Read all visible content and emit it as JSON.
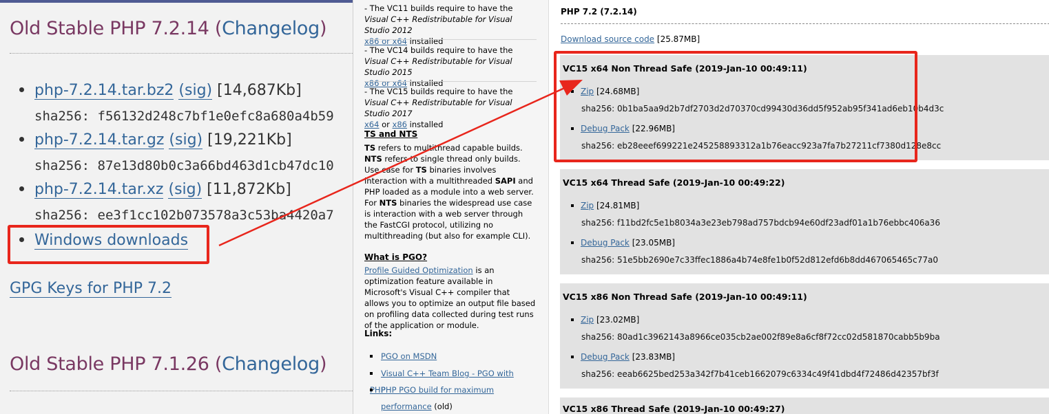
{
  "left": {
    "title1_pre": "Old Stable PHP 7.2.14 (",
    "title1_link": "Changelog",
    "title1_post": ")",
    "files": [
      {
        "name": "php-7.2.14.tar.bz2",
        "sig": "(sig)",
        "size": "[14,687Kb]",
        "sha": "sha256: f56132d248c7bf1e0efc8a680a4b59"
      },
      {
        "name": "php-7.2.14.tar.gz",
        "sig": "(sig)",
        "size": "[19,221Kb]",
        "sha": "sha256: 87e13d80b0c3a66bd463d1cb47dc10"
      },
      {
        "name": "php-7.2.14.tar.xz",
        "sig": "(sig)",
        "size": "[11,872Kb]",
        "sha": "sha256: ee3f1cc102b073578a3c53ba4420a7"
      }
    ],
    "windows_downloads": "Windows downloads",
    "gpg_keys": "GPG Keys for PHP 7.2",
    "title2_pre": "Old Stable PHP 7.1.26 (",
    "title2_link": "Changelog",
    "title2_post": ")"
  },
  "mid": {
    "vc11_a": "- The VC11 builds require to have the ",
    "vc11_i": "Visual C++ Redistributable for Visual Studio 2012",
    "vc11_link": "x86 or x64",
    "vc11_b": " installed",
    "vc14_a": "- The VC14 builds require to have the ",
    "vc14_i": "Visual C++ Redistributable for Visual Studio 2015",
    "vc14_link": "x86 or x64",
    "vc14_b": " installed",
    "vc15_a": "- The VC15 builds require to have the ",
    "vc15_i": "Visual C++ Redistributable for Visual Studio 2017",
    "vc15_link1": "x64",
    "vc15_or": " or ",
    "vc15_link2": "x86",
    "vc15_b": " installed",
    "ts_heading": "TS and NTS",
    "ts_1": "TS",
    "ts_2": " refers to multithread capable builds. ",
    "ts_3": "NTS",
    "ts_4": " refers to single thread only builds. Use case for ",
    "ts_5": "TS",
    "ts_6": " binaries involves interaction with a multithreaded ",
    "ts_7": "SAPI",
    "ts_8": " and PHP loaded as a module into a web server. For ",
    "ts_9": "NTS",
    "ts_10": " binaries the widespread use case is interaction with a web server through the FastCGI protocol, utilizing no multithreading (but also for example CLI).",
    "pgo_heading": "What is PGO?",
    "pgo_link": "Profile Guided Optimization",
    "pgo_text": " is an optimization feature available in Microsoft's Visual C++ compiler that allows you to optimize an output file based on profiling data collected during test runs of the application or module.",
    "links_heading": "Links:",
    "links": [
      "PGO on MSDN",
      "Visual C++ Team Blog - PGO with PHP",
      "PHP PGO build for maximum"
    ],
    "links_last_cont": "performance",
    "links_last_suffix": " (old)"
  },
  "right": {
    "title": "PHP 7.2 (7.2.14)",
    "source_link": "Download source code",
    "source_size": " [25.87MB]",
    "builds": [
      {
        "title": "VC15 x64 Non Thread Safe (2019-Jan-10 00:49:11)",
        "zip": "Zip",
        "zip_size": " [24.68MB]",
        "zip_sha": "sha256: 0b1ba5aa9d2b7df2703d2d70370cd99430d36dd5f952ab95f341ad6eb10b4d3c",
        "debug": "Debug Pack",
        "debug_size": " [22.96MB]",
        "debug_sha": "sha256: eb28eeef699221e245258893312a1b76eacc923a7fa7b27211cf7380d128e8cc"
      },
      {
        "title": "VC15 x64 Thread Safe (2019-Jan-10 00:49:22)",
        "zip": "Zip",
        "zip_size": " [24.81MB]",
        "zip_sha": "sha256: f11bd2fc5e1b8034a3e23eb798ad757bdcb94e60df23adf01a1b76ebbc406a36",
        "debug": "Debug Pack",
        "debug_size": " [23.05MB]",
        "debug_sha": "sha256: 51e5bb2690e7c33ffec1886a4b74e8fe1b0f52d812efd6b8dd467065465c77a0"
      },
      {
        "title": "VC15 x86 Non Thread Safe (2019-Jan-10 00:49:11)",
        "zip": "Zip",
        "zip_size": " [23.02MB]",
        "zip_sha": "sha256: 80ad1c3962143a8966ce035cb2ae002f89e8a6cf8f72cc02d581870cabb5b9ba",
        "debug": "Debug Pack",
        "debug_size": " [23.83MB]",
        "debug_sha": "sha256: eeab6625bed253a342f7b41ceb1662079c6334c49f41dbd4f72486d42357bf3f"
      },
      {
        "title": "VC15 x86 Thread Safe (2019-Jan-10 00:49:27)"
      }
    ]
  },
  "highlight_color": "#e8261c"
}
